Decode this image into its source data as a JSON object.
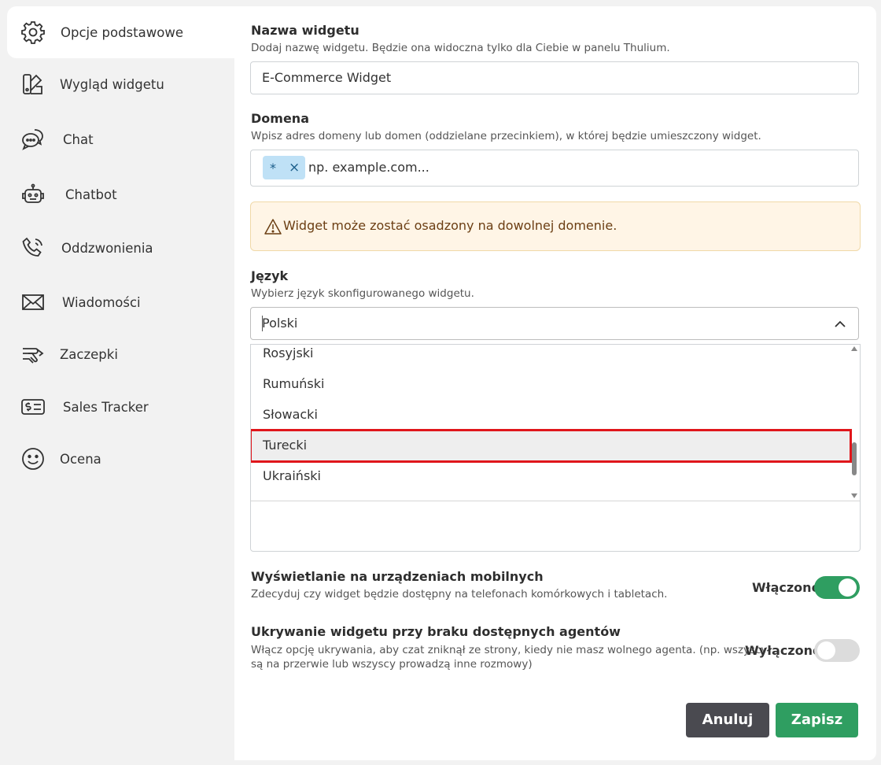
{
  "sidebar": {
    "items": [
      {
        "label": "Opcje podstawowe",
        "icon": "gear-icon"
      },
      {
        "label": "Wygląd widgetu",
        "icon": "palette-icon"
      },
      {
        "label": "Chat",
        "icon": "chat-bubbles-icon"
      },
      {
        "label": "Chatbot",
        "icon": "robot-icon"
      },
      {
        "label": "Oddzwonienia",
        "icon": "phone-callback-icon"
      },
      {
        "label": "Wiadomości",
        "icon": "envelope-icon"
      },
      {
        "label": "Zaczepki",
        "icon": "hand-wave-icon"
      },
      {
        "label": "Sales Tracker",
        "icon": "dollar-receipt-icon"
      },
      {
        "label": "Ocena",
        "icon": "smiley-icon"
      }
    ]
  },
  "form": {
    "name": {
      "title": "Nazwa widgetu",
      "desc": "Dodaj nazwę widgetu. Będzie ona widoczna tylko dla Ciebie w panelu Thulium.",
      "value": "E-Commerce Widget"
    },
    "domain": {
      "title": "Domena",
      "desc": "Wpisz adres domeny lub domen (oddzielane przecinkiem), w której będzie umieszczony widget.",
      "chip": "*",
      "chip_remove": "×",
      "placeholder": "np. example.com..."
    },
    "alert": "Widget może zostać osadzony na dowolnej domenie.",
    "language": {
      "title": "Język",
      "desc": "Wybierz język skonfigurowanego widgetu.",
      "placeholder": "Polski",
      "options": [
        "Rosyjski",
        "Rumuński",
        "Słowacki",
        "Turecki",
        "Ukraiński"
      ],
      "highlighted": "Turecki"
    },
    "mobile": {
      "title": "Wyświetlanie na urządzeniach mobilnych",
      "desc": "Zdecyduj czy widget będzie dostępny na telefonach komórkowych i tabletach.",
      "state_label": "Włączone",
      "on": true
    },
    "hide": {
      "title": "Ukrywanie widgetu przy braku dostępnych agentów",
      "desc_line1": "Włącz opcję ukrywania, aby czat zniknął ze strony, kiedy nie masz wolnego agenta. (np. wszyscy",
      "desc_line2": "są na przerwie lub wszyscy prowadzą inne rozmowy)",
      "state_label": "Wyłączone",
      "on": false
    }
  },
  "buttons": {
    "cancel": "Anuluj",
    "save": "Zapisz"
  },
  "colors": {
    "accent_green": "#2f9e61",
    "highlight_red": "#e0161b",
    "chip_blue": "#bfe1f6",
    "alert_bg": "#fff5e6"
  }
}
